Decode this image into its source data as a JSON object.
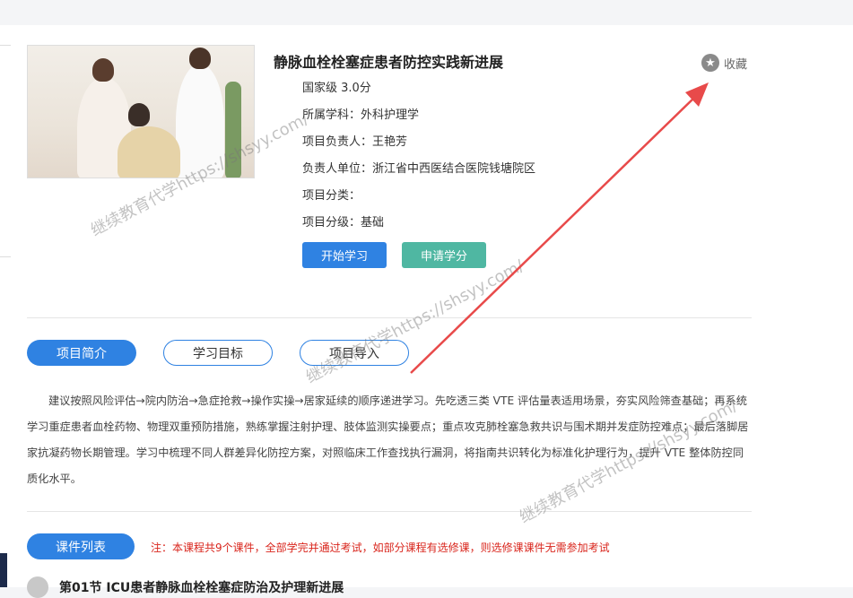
{
  "course": {
    "title": "静脉血栓栓塞症患者防控实践新进展",
    "favorite_label": "收藏",
    "credit": "国家级 3.0分",
    "discipline": "所属学科：外科护理学",
    "leader": "项目负责人：王艳芳",
    "unit": "负责人单位：浙江省中西医结合医院钱塘院区",
    "category": "项目分类：",
    "level": "项目分级：基础"
  },
  "buttons": {
    "start": "开始学习",
    "apply": "申请学分"
  },
  "tabs": [
    {
      "label": "项目简介",
      "active": true
    },
    {
      "label": "学习目标",
      "active": false
    },
    {
      "label": "项目导入",
      "active": false
    }
  ],
  "intro": "建议按照风险评估→院内防治→急症抢救→操作实操→居家延续的顺序递进学习。先吃透三类 VTE 评估量表适用场景，夯实风险筛查基础；再系统学习重症患者血栓药物、物理双重预防措施，熟练掌握注射护理、肢体监测实操要点；重点攻克肺栓塞急救共识与围术期并发症防控难点；最后落脚居家抗凝药物长期管理。学习中梳理不同人群差异化防控方案，对照临床工作查找执行漏洞，将指南共识转化为标准化护理行为，提升 VTE 整体防控同质化水平。",
  "course_list": {
    "label": "课件列表",
    "note": "注：本课程共9个课件，全部学完并通过考试，如部分课程有选修课，则选修课课件无需参加考试",
    "first_item": "第01节 ICU患者静脉血栓栓塞症防治及护理新进展"
  },
  "watermark": "继续教育代学https://shsyy.com/",
  "colors": {
    "primary": "#2f82e2",
    "apply_green": "#4fb7a2",
    "note_red": "#d9251c",
    "arrow_red": "#e84a4a"
  },
  "icons": {
    "favorite": "star-icon"
  }
}
